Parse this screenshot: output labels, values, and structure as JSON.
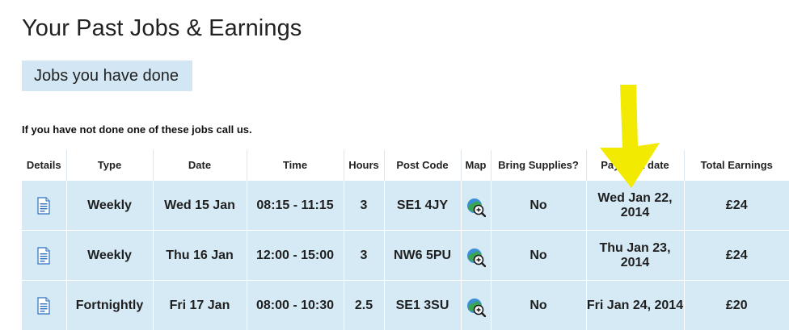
{
  "page": {
    "title": "Your Past Jobs & Earnings",
    "tab_label": "Jobs you have done",
    "notice": "If you have not done one of these jobs call us."
  },
  "table": {
    "headers": {
      "details": "Details",
      "type": "Type",
      "date": "Date",
      "time": "Time",
      "hours": "Hours",
      "postcode": "Post Code",
      "map": "Map",
      "supplies": "Bring Supplies?",
      "payment_date": "Payment date",
      "earnings": "Total Earnings"
    },
    "rows": [
      {
        "details_icon": "document-icon",
        "type": "Weekly",
        "date": "Wed 15 Jan",
        "time": "08:15 - 11:15",
        "hours": "3",
        "postcode": "SE1 4JY",
        "map_icon": "map-zoom-icon",
        "supplies": "No",
        "payment_date_line1": "Wed Jan 22,",
        "payment_date_line2": "2014",
        "earnings": "£24"
      },
      {
        "details_icon": "document-icon",
        "type": "Weekly",
        "date": "Thu 16 Jan",
        "time": "12:00 - 15:00",
        "hours": "3",
        "postcode": "NW6 5PU",
        "map_icon": "map-zoom-icon",
        "supplies": "No",
        "payment_date_line1": "Thu Jan 23,",
        "payment_date_line2": "2014",
        "earnings": "£24"
      },
      {
        "details_icon": "document-icon",
        "type": "Fortnightly",
        "date": "Fri 17 Jan",
        "time": "08:00 - 10:30",
        "hours": "2.5",
        "postcode": "SE1 3SU",
        "map_icon": "map-zoom-icon",
        "supplies": "No",
        "payment_date_line1": "Fri Jan 24, 2014",
        "payment_date_line2": "",
        "earnings": "£20"
      }
    ]
  },
  "annotation": {
    "arrow_icon": "yellow-arrow-icon",
    "arrow_color": "#f2ea00"
  },
  "colors": {
    "row_background": "#d6eaf6",
    "tab_background": "#d2e7f3",
    "icon_blue": "#2b6fbe"
  }
}
